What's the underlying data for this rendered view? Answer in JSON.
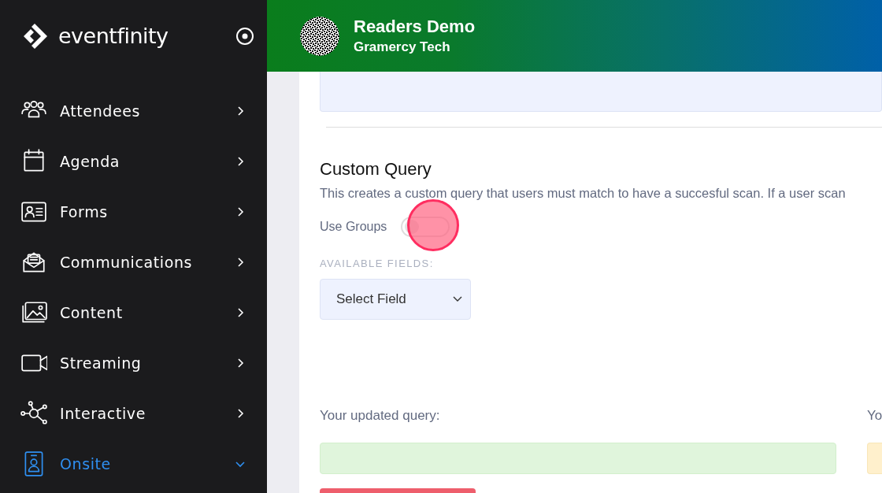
{
  "sidebar": {
    "logo_text": "eventfinity",
    "items": [
      {
        "label": "Attendees",
        "selected": false,
        "expanded": false
      },
      {
        "label": "Agenda",
        "selected": false,
        "expanded": false
      },
      {
        "label": "Forms",
        "selected": false,
        "expanded": false
      },
      {
        "label": "Communications",
        "selected": false,
        "expanded": false
      },
      {
        "label": "Content",
        "selected": false,
        "expanded": false
      },
      {
        "label": "Streaming",
        "selected": false,
        "expanded": false
      },
      {
        "label": "Interactive",
        "selected": false,
        "expanded": false
      },
      {
        "label": "Onsite",
        "selected": true,
        "expanded": true
      }
    ]
  },
  "header": {
    "title": "Readers Demo",
    "subtitle": "Gramercy Tech"
  },
  "custom_query": {
    "title": "Custom Query",
    "description": "This creates a custom query that users must match to have a succesful scan. If a user scan",
    "use_groups": {
      "label": "Use Groups",
      "on": false
    },
    "fields_label": "AVAILABLE FIELDS:",
    "select": {
      "value": "Select Field"
    },
    "updated_query": {
      "label": "Your updated query:"
    },
    "right_column": {
      "label": "Yo"
    }
  }
}
